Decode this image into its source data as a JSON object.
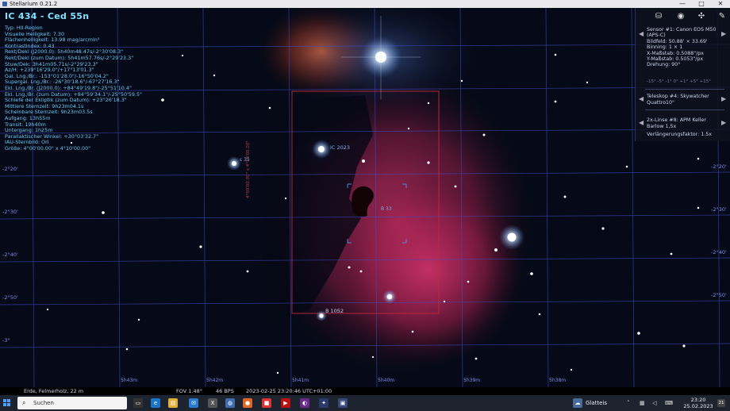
{
  "window": {
    "title": "Stellarium 0.21.2",
    "minimize": "—",
    "maximize": "□",
    "close": "✕"
  },
  "info": {
    "title": "IC 434 - Ced 55n",
    "lines": [
      "Typ: HII-Region",
      "Visuelle Helligkeit: 7.30",
      "Flächenhelligkeit: 13.98 mag/arcmin²",
      "Kontrastindex: 0.43",
      "Rekt/Dekl (J2000.0): 5h40m48.47s/-2°30'08.3\"",
      "Rekt/Dekl (zum Datum): 5h41m57.76s/-2°29'23.3\"",
      "Stuw/Dek: 3h41m05.71s/-2°29'23.3\"",
      "Az/H: +239°16'29.0\"/+17°13'01.3\"",
      "Gal. Lng./Br.: -153°01'28.0\"/-16°50'04.2\"",
      "Supergal. Lng./Br.: -26°30'18.6\"/-67°27'16.3\"",
      "Ekl. Lng./Br. (J2000.0): +84°49'19.8\"/-25°51'10.4\"",
      "Ekl. Lng./Br. (zum Datum): +84°59'34.1\"/-25°50'59.5\"",
      "Schiefe der Ekliptik (zum Datum): +23°26'18.3\"",
      "Mittlere Sternzeit: 9h23m04.1s",
      "Scheinbare Sternzeit: 9h23m03.5s",
      "Aufgang: 13h55m",
      "Transit: 19h40m",
      "Untergang: 1h25m",
      "Parallaktischer Winkel: +30°03'32.7\"",
      "IAU-Sternbild: Ori",
      "Größe: 4°00'00.00\" x 4°10'00.00\""
    ]
  },
  "ocular_panel": {
    "sensor": [
      "Sensor #1: Canon EOS M50",
      "(APS-C)",
      "Bildfeld: 50.88' × 33.69'",
      "Binning: 1 × 1",
      "X-Maßstab: 0.5088\"/px",
      "Y-Maßstab: 0.5053\"/px",
      "Drehung: 90°"
    ],
    "rotation_scale": "-15° -5° -1° 0° +1° +5° +15°",
    "telescope": [
      "Teleskop #4: Skywatcher",
      "Quattro10\""
    ],
    "lens": [
      "2x-Linse #8: APM Keller",
      "Barlow 1,5x"
    ],
    "extender": "Verlängerungsfaktor: 1.5x",
    "prev_arrow": "◀",
    "next_arrow": "▶"
  },
  "sky_labels": {
    "dec_ticks": [
      "-2°20'",
      "-2°30'",
      "-2°40'",
      "-2°50'",
      "-3°"
    ],
    "ra_ticks": [
      "5h43m",
      "5h42m",
      "5h41m",
      "5h40m",
      "5h39m",
      "5h38m"
    ],
    "objects": [
      "IC 2023",
      "B 1052",
      "B 33",
      "ε 35"
    ],
    "frame_label": "4°00'00.00\" x 4°10'00.00\""
  },
  "status": {
    "location": "Erde, Felmerholz, 22 m",
    "fov": "FOV 1.48°",
    "fps": "46 BPS",
    "datetime": "2023-02-25 23:20:46 UTC+01:00"
  },
  "taskbar": {
    "search_label": "Suchen",
    "weather": "Glatteis",
    "time": "23:20",
    "date": "25.02.2023",
    "notif": "21"
  },
  "colors": {
    "accent": "#6bd3ff",
    "grid": "#3f4ec8",
    "nebula": "#c42c5a",
    "frame": "#c22a3a"
  }
}
